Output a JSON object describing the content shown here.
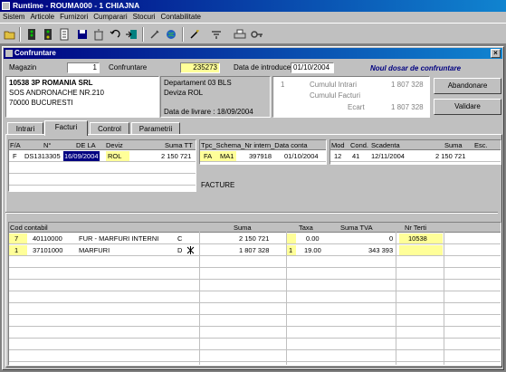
{
  "app": {
    "title": "Runtime - ROUMA000 -  1  CHIAJNA"
  },
  "menu": [
    "Sistem",
    "Articole",
    "Furnizori",
    "Cumparari",
    "Stocuri",
    "Contabilitate"
  ],
  "window": {
    "title": "Confruntare",
    "close": "×"
  },
  "header": {
    "magazin_label": "Magazin",
    "magazin_value": "1",
    "confruntare_label": "Confruntare",
    "confruntare_value": "235273",
    "data_intro_label": "Data de introduce",
    "data_intro_value": "01/10/2004",
    "new_dossier": "Noul dosar de confruntare"
  },
  "supplier": {
    "line1": "10538 3P ROMANIA SRL",
    "line2": "SOS ANDRONACHE NR.210",
    "line3": "70000 BUCURESTI"
  },
  "info": {
    "department": "Departament 03 BLS",
    "deviza": "Deviza ROL",
    "delivery": "Data de livrare : 18/09/2004"
  },
  "totals": {
    "one": "1",
    "intrari_label": "Cumulul Intrari",
    "intrari_value": "1 807 328",
    "facturi_label": "Cumulul Facturi",
    "ecart_label": "Ecart",
    "ecart_value": "1 807 328"
  },
  "buttons": {
    "abandon": "Abandonare",
    "validate": "Validare"
  },
  "tabs": [
    "Intrari",
    "Facturi",
    "Control",
    "Parametrii"
  ],
  "invoices": {
    "headers": [
      "F/A",
      "N°",
      "DE LA",
      "Deviz",
      "Suma TT"
    ],
    "row": {
      "fa": "F",
      "no": "DS1313305",
      "date": "16/09/2004",
      "deviz": "ROL",
      "sum": "2 150 721"
    }
  },
  "schema": {
    "headers": [
      "Tpc_Schema_Nr intern_Data conta"
    ],
    "row": {
      "tpc": "FA",
      "schema": "MA1",
      "nr": "397918",
      "date": "01/10/2004"
    },
    "label": "FACTURE"
  },
  "payments": {
    "headers": [
      "Mod",
      "Cond.",
      "Scadenta",
      "Suma",
      "Esc."
    ],
    "row": {
      "mod": "12",
      "cond": "41",
      "scad": "12/11/2004",
      "sum": "2 150 721"
    }
  },
  "accounts": {
    "headers": [
      "Cod contabil",
      "Suma",
      "Taxa",
      "Suma TVA",
      "Nr Terti"
    ],
    "rows": [
      {
        "n": "7",
        "code": "40110000",
        "name": "FUR - MARFURI INTERNI",
        "dc": "C",
        "sum": "2 150 721",
        "taxa": "0.00",
        "tva": "0",
        "terti": "10538"
      },
      {
        "n": "1",
        "code": "37101000",
        "name": "MARFURI",
        "dc": "D",
        "sum": "1 807 328",
        "taxa_n": "1",
        "taxa": "19.00",
        "tva": "343 393",
        "terti": ""
      }
    ]
  }
}
